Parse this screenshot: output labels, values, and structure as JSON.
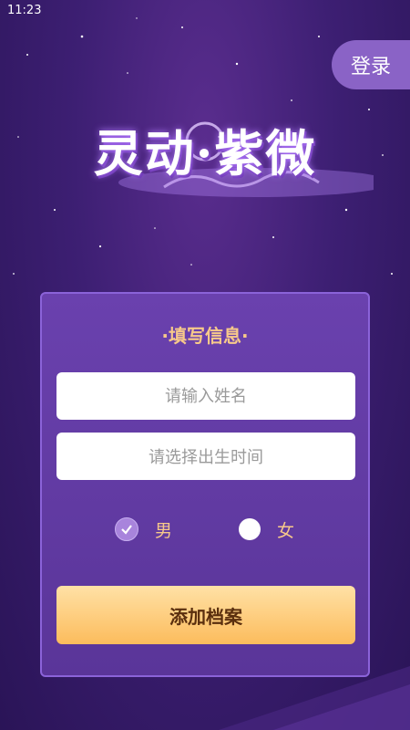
{
  "status_bar": {
    "time": "11:23"
  },
  "header": {
    "login_label": "登录"
  },
  "logo": {
    "text": "灵动·紫微"
  },
  "form": {
    "title": "·填写信息·",
    "name_placeholder": "请输入姓名",
    "birth_placeholder": "请选择出生时间",
    "gender_options": [
      {
        "label": "男",
        "selected": true
      },
      {
        "label": "女",
        "selected": false
      }
    ],
    "submit_label": "添加档案"
  },
  "colors": {
    "background": "#3d1f73",
    "card": "#6a41ae",
    "accent_gold": "#f7c98a",
    "button_gradient_top": "#ffe1a6",
    "button_gradient_bottom": "#fcbc5c"
  }
}
